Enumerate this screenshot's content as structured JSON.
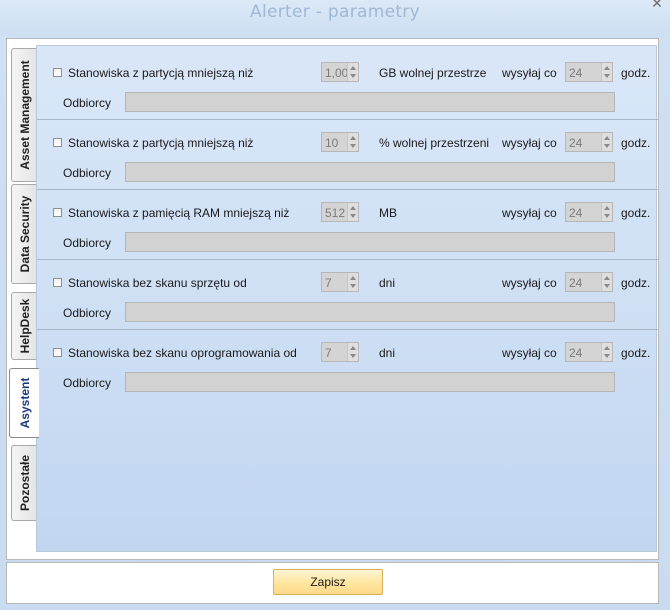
{
  "window": {
    "title": "Alerter - parametry"
  },
  "tabs": [
    {
      "label": "Asset Management",
      "active": false
    },
    {
      "label": "Data Security",
      "active": false
    },
    {
      "label": "HelpDesk",
      "active": false
    },
    {
      "label": "Asystent",
      "active": true
    },
    {
      "label": "Pozostałe",
      "active": false
    }
  ],
  "rows": [
    {
      "label": "Stanowiska z partycją mniejszą niż",
      "value": "1,00",
      "unit": "GB wolnej przestrze",
      "send_label": "wysyłaj co",
      "send_value": "24",
      "send_unit": "godz.",
      "recipients_label": "Odbiorcy",
      "recipients_value": ""
    },
    {
      "label": "Stanowiska z partycją mniejszą niż",
      "value": "10",
      "unit": "% wolnej przestrzeni",
      "send_label": "wysyłaj co",
      "send_value": "24",
      "send_unit": "godz.",
      "recipients_label": "Odbiorcy",
      "recipients_value": ""
    },
    {
      "label": "Stanowiska z pamięcią RAM mniejszą niż",
      "value": "512",
      "unit": "MB",
      "send_label": "wysyłaj co",
      "send_value": "24",
      "send_unit": "godz.",
      "recipients_label": "Odbiorcy",
      "recipients_value": ""
    },
    {
      "label": "Stanowiska bez skanu sprzętu od",
      "value": "7",
      "unit": "dni",
      "send_label": "wysyłaj co",
      "send_value": "24",
      "send_unit": "godz.",
      "recipients_label": "Odbiorcy",
      "recipients_value": ""
    },
    {
      "label": "Stanowiska bez skanu oprogramowania od",
      "value": "7",
      "unit": "dni",
      "send_label": "wysyłaj co",
      "send_value": "24",
      "send_unit": "godz.",
      "recipients_label": "Odbiorcy",
      "recipients_value": ""
    }
  ],
  "footer": {
    "save_label": "Zapisz"
  },
  "icons": {
    "close": "close-icon",
    "spin_up": "chevron-up-icon",
    "spin_down": "chevron-down-icon"
  },
  "colors": {
    "panel_top": "#d9e7f8",
    "panel_bottom": "#c2d6f0",
    "title": "#9fb8d6",
    "active_tab_text": "#1a3a7a",
    "save_button": "#ffe7a2"
  }
}
